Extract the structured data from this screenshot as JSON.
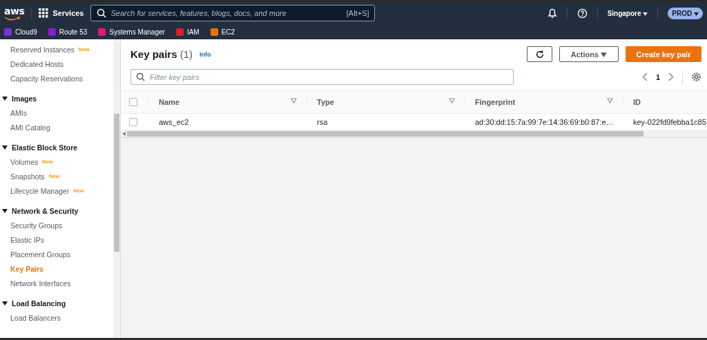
{
  "topbar": {
    "logo": "aws",
    "services_label": "Services",
    "search": {
      "placeholder": "Search for services, features, blogs, docs, and more",
      "shortcut": "[Alt+S]"
    },
    "region": "Singapore",
    "account": "PROD"
  },
  "favorites": [
    {
      "label": "Cloud9",
      "color": "#7b2fd6"
    },
    {
      "label": "Route 53",
      "color": "#8c1ad6"
    },
    {
      "label": "Systems Manager",
      "color": "#e7157b"
    },
    {
      "label": "IAM",
      "color": "#dd1f27"
    },
    {
      "label": "EC2",
      "color": "#ed7100"
    }
  ],
  "sidebar": {
    "items": [
      {
        "kind": "link",
        "label": "Reserved Instances",
        "badge": "New",
        "selected": false
      },
      {
        "kind": "link",
        "label": "Dedicated Hosts",
        "selected": false
      },
      {
        "kind": "link",
        "label": "Capacity Reservations",
        "selected": false
      },
      {
        "kind": "section",
        "label": "Images",
        "expanded": true,
        "children": [
          {
            "kind": "link",
            "label": "AMIs",
            "selected": false
          },
          {
            "kind": "link",
            "label": "AMI Catalog",
            "selected": false
          }
        ]
      },
      {
        "kind": "section",
        "label": "Elastic Block Store",
        "expanded": true,
        "children": [
          {
            "kind": "link",
            "label": "Volumes",
            "badge": "New",
            "selected": false
          },
          {
            "kind": "link",
            "label": "Snapshots",
            "badge": "New",
            "selected": false
          },
          {
            "kind": "link",
            "label": "Lifecycle Manager",
            "badge": "New",
            "selected": false
          }
        ]
      },
      {
        "kind": "section",
        "label": "Network & Security",
        "expanded": true,
        "children": [
          {
            "kind": "link",
            "label": "Security Groups",
            "selected": false
          },
          {
            "kind": "link",
            "label": "Elastic IPs",
            "selected": false
          },
          {
            "kind": "link",
            "label": "Placement Groups",
            "selected": false
          },
          {
            "kind": "link",
            "label": "Key Pairs",
            "selected": true
          },
          {
            "kind": "link",
            "label": "Network Interfaces",
            "selected": false
          }
        ]
      },
      {
        "kind": "section",
        "label": "Load Balancing",
        "expanded": true,
        "children": [
          {
            "kind": "link",
            "label": "Load Balancers",
            "selected": false
          }
        ]
      }
    ]
  },
  "panel": {
    "title": "Key pairs",
    "count": "(1)",
    "info": "Info",
    "actions_label": "Actions",
    "create_label": "Create key pair",
    "filter": {
      "placeholder": "Filter key pairs"
    },
    "page": "1"
  },
  "table": {
    "select_all_checked": false,
    "columns": [
      {
        "label": "Name",
        "sortable": true
      },
      {
        "label": "Type",
        "sortable": true
      },
      {
        "label": "Fingerprint",
        "sortable": true
      },
      {
        "label": "ID",
        "sortable": false
      }
    ],
    "rows": [
      {
        "checked": false,
        "cells": [
          "aws_ec2",
          "rsa",
          "ad:30:dd:15:7a:99:7e:14:36:69:b0:87:e…",
          "key-022fd9febba1c85"
        ]
      }
    ]
  }
}
